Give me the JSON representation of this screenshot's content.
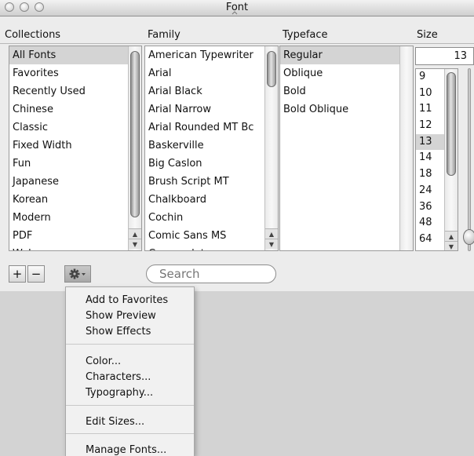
{
  "window": {
    "title": "Font"
  },
  "columns": {
    "collections": "Collections",
    "family": "Family",
    "typeface": "Typeface",
    "size": "Size"
  },
  "collections": [
    "All Fonts",
    "Favorites",
    "Recently Used",
    "Chinese",
    "Classic",
    "Fixed Width",
    "Fun",
    "Japanese",
    "Korean",
    "Modern",
    "PDF",
    "Web"
  ],
  "families": [
    "American Typewriter",
    "Arial",
    "Arial Black",
    "Arial Narrow",
    "Arial Rounded MT Bc",
    "Baskerville",
    "Big Caslon",
    "Brush Script MT",
    "Chalkboard",
    "Cochin",
    "Comic Sans MS",
    "Copperplate"
  ],
  "typefaces": [
    "Regular",
    "Oblique",
    "Bold",
    "Bold Oblique"
  ],
  "size": {
    "current": "13",
    "options": [
      "9",
      "10",
      "11",
      "12",
      "13",
      "14",
      "18",
      "24",
      "36",
      "48",
      "64"
    ]
  },
  "toolbar": {
    "add_label": "+",
    "remove_label": "−",
    "search_placeholder": "Search",
    "action_icon": "gear-icon"
  },
  "menu": {
    "items": [
      "Add to Favorites",
      "Show Preview",
      "Show Effects",
      "Color...",
      "Characters...",
      "Typography...",
      "Edit Sizes...",
      "Manage Fonts..."
    ]
  }
}
